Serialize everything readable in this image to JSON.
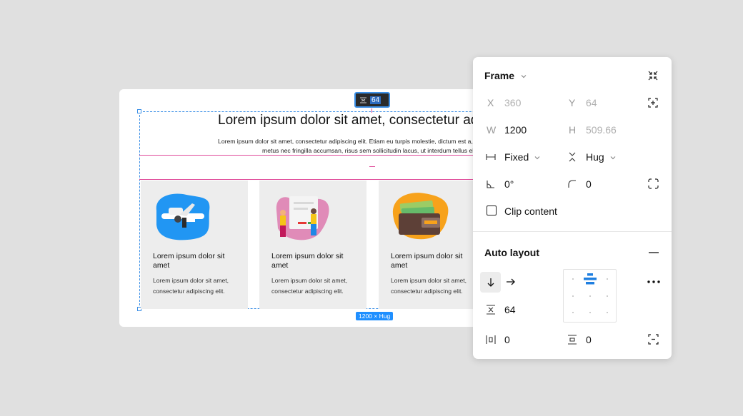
{
  "canvas": {
    "title": "Lorem ipsum dolor sit amet, consectetur adip",
    "body_line1": "Lorem ipsum dolor sit amet, consectetur adipiscing elit. Etiam eu turpis molestie, dictum est a, matt",
    "body_line2": "metus nec fringilla accumsan, risus sem sollicitudin lacus, ut interdum tellus elit se",
    "cards": [
      {
        "title": "Lorem ipsum dolor sit amet",
        "text": "Lorem ipsum dolor sit amet, consectetur adipiscing elit.",
        "illustration": "airplane-illustration",
        "blob_color": "#2196f3"
      },
      {
        "title": "Lorem ipsum dolor sit amet",
        "text": "Lorem ipsum dolor sit amet, consectetur adipiscing elit.",
        "illustration": "people-board-illustration",
        "blob_color": "#e08bb8"
      },
      {
        "title": "Lorem ipsum dolor sit amet",
        "text": "Lorem ipsum dolor sit amet, consectetur adipiscing elit.",
        "illustration": "wallet-illustration",
        "blob_color": "#f7a21b"
      }
    ],
    "spacing_badge": "64",
    "size_badge": "1200 × Hug"
  },
  "panel": {
    "frame_title": "Frame",
    "x_label": "X",
    "x_value": "360",
    "y_label": "Y",
    "y_value": "64",
    "w_label": "W",
    "w_value": "1200",
    "h_label": "H",
    "h_value": "509.66",
    "width_mode": "Fixed",
    "height_mode": "Hug",
    "rotation": "0°",
    "radius": "0",
    "clip_content_label": "Clip content",
    "auto_layout_title": "Auto layout",
    "gap_value": "64",
    "padding_horizontal": "0",
    "padding_vertical": "0"
  },
  "colors": {
    "accent": "#3b8fe6",
    "spacing": "#e04b9a",
    "badge_blue": "#1f8fff"
  }
}
